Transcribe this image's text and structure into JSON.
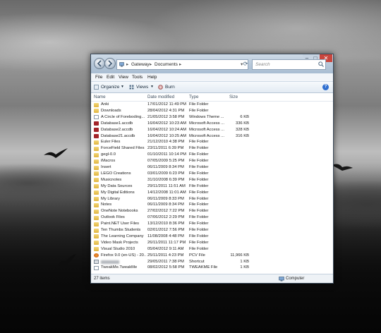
{
  "window": {
    "address_segments": [
      "Gateway",
      "Documents"
    ],
    "search_placeholder": "Search",
    "controls": [
      "–",
      "□",
      "✕"
    ]
  },
  "menu": [
    "File",
    "Edit",
    "View",
    "Tools",
    "Help"
  ],
  "toolbar": {
    "organize": "Organize",
    "views": "Views",
    "burn": "Burn"
  },
  "columns": [
    "Name",
    "Date modified",
    "Type",
    "Size"
  ],
  "files": [
    {
      "name": "Anki",
      "date": "17/01/2012 11:49 PM",
      "type": "File Folder",
      "size": "",
      "icon": "folder-icon"
    },
    {
      "name": "Downloads",
      "date": "28/04/2012 4:31 PM",
      "type": "File Folder",
      "size": "",
      "icon": "folder-icon"
    },
    {
      "name": "A Circle of Foreboding...",
      "date": "21/05/2012 3:58 PM",
      "type": "Windows Theme ...",
      "size": "6 KB",
      "icon": "file-icon"
    },
    {
      "name": "Database1.accdb",
      "date": "16/04/2012 10:23 AM",
      "type": "Microsoft Access ...",
      "size": "336 KB",
      "icon": "access-db-icon"
    },
    {
      "name": "Database2.accdb",
      "date": "16/04/2012 10:24 AM",
      "type": "Microsoft Access ...",
      "size": "328 KB",
      "icon": "access-db-icon"
    },
    {
      "name": "Database21.accdb",
      "date": "16/04/2012 10:25 AM",
      "type": "Microsoft Access ...",
      "size": "316 KB",
      "icon": "access-db-icon"
    },
    {
      "name": "Euler Files",
      "date": "21/12/2010 4:38 PM",
      "type": "File Folder",
      "size": "",
      "icon": "folder-icon"
    },
    {
      "name": "ForceField Shared Files",
      "date": "23/11/2011 6:39 PM",
      "type": "File Folder",
      "size": "",
      "icon": "folder-icon"
    },
    {
      "name": "gegl-0.0",
      "date": "01/10/2011 10:14 PM",
      "type": "File Folder",
      "size": "",
      "icon": "folder-icon"
    },
    {
      "name": "iMacros",
      "date": "07/05/2009 5:25 PM",
      "type": "File Folder",
      "size": "",
      "icon": "folder-icon"
    },
    {
      "name": "Insert",
      "date": "06/11/2009 8:34 PM",
      "type": "File Folder",
      "size": "",
      "icon": "folder-icon"
    },
    {
      "name": "LEGO Creations",
      "date": "03/01/2009 6:23 PM",
      "type": "File Folder",
      "size": "",
      "icon": "folder-icon"
    },
    {
      "name": "Musicnotes",
      "date": "31/10/2008 6:39 PM",
      "type": "File Folder",
      "size": "",
      "icon": "folder-icon"
    },
    {
      "name": "My Data Sources",
      "date": "29/11/2011 11:51 AM",
      "type": "File Folder",
      "size": "",
      "icon": "folder-icon"
    },
    {
      "name": "My Digital Editions",
      "date": "14/12/2008 11:01 AM",
      "type": "File Folder",
      "size": "",
      "icon": "folder-icon"
    },
    {
      "name": "My Library",
      "date": "06/11/2009 8:33 PM",
      "type": "File Folder",
      "size": "",
      "icon": "folder-icon"
    },
    {
      "name": "Notes",
      "date": "06/11/2009 8:34 PM",
      "type": "File Folder",
      "size": "",
      "icon": "folder-icon"
    },
    {
      "name": "OneNote Notebooks",
      "date": "27/02/2012 7:22 PM",
      "type": "File Folder",
      "size": "",
      "icon": "folder-icon"
    },
    {
      "name": "Outlook Files",
      "date": "07/06/2012 2:29 PM",
      "type": "File Folder",
      "size": "",
      "icon": "folder-icon"
    },
    {
      "name": "Paint.NET User Files",
      "date": "13/12/2010 8:36 PM",
      "type": "File Folder",
      "size": "",
      "icon": "folder-icon"
    },
    {
      "name": "Ten Thumbs Students",
      "date": "02/01/2012 7:56 PM",
      "type": "File Folder",
      "size": "",
      "icon": "folder-icon"
    },
    {
      "name": "The Learning Company",
      "date": "11/08/2008 4:48 PM",
      "type": "File Folder",
      "size": "",
      "icon": "folder-icon"
    },
    {
      "name": "Video Mask Projects",
      "date": "26/11/2011 11:17 PM",
      "type": "File Folder",
      "size": "",
      "icon": "folder-icon"
    },
    {
      "name": "Visual Studio 2010",
      "date": "05/04/2012 9:11 AM",
      "type": "File Folder",
      "size": "",
      "icon": "folder-icon"
    },
    {
      "name": "Firefox 9.0 (en-US) - 20...",
      "date": "25/11/2011 4:23 PM",
      "type": "PCV File",
      "size": "11,966 KB",
      "icon": "firefox-icon"
    },
    {
      "name": "",
      "date": "29/05/2011 7:38 PM",
      "type": "Shortcut",
      "size": "1 KB",
      "icon": "shortcut-icon"
    },
    {
      "name": "TweakMe.TweakMe",
      "date": "08/02/2012 5:58 PM",
      "type": "TWEAKME File",
      "size": "1 KB",
      "icon": "file-icon"
    }
  ],
  "status": {
    "count": "27 items",
    "location": "Computer"
  }
}
